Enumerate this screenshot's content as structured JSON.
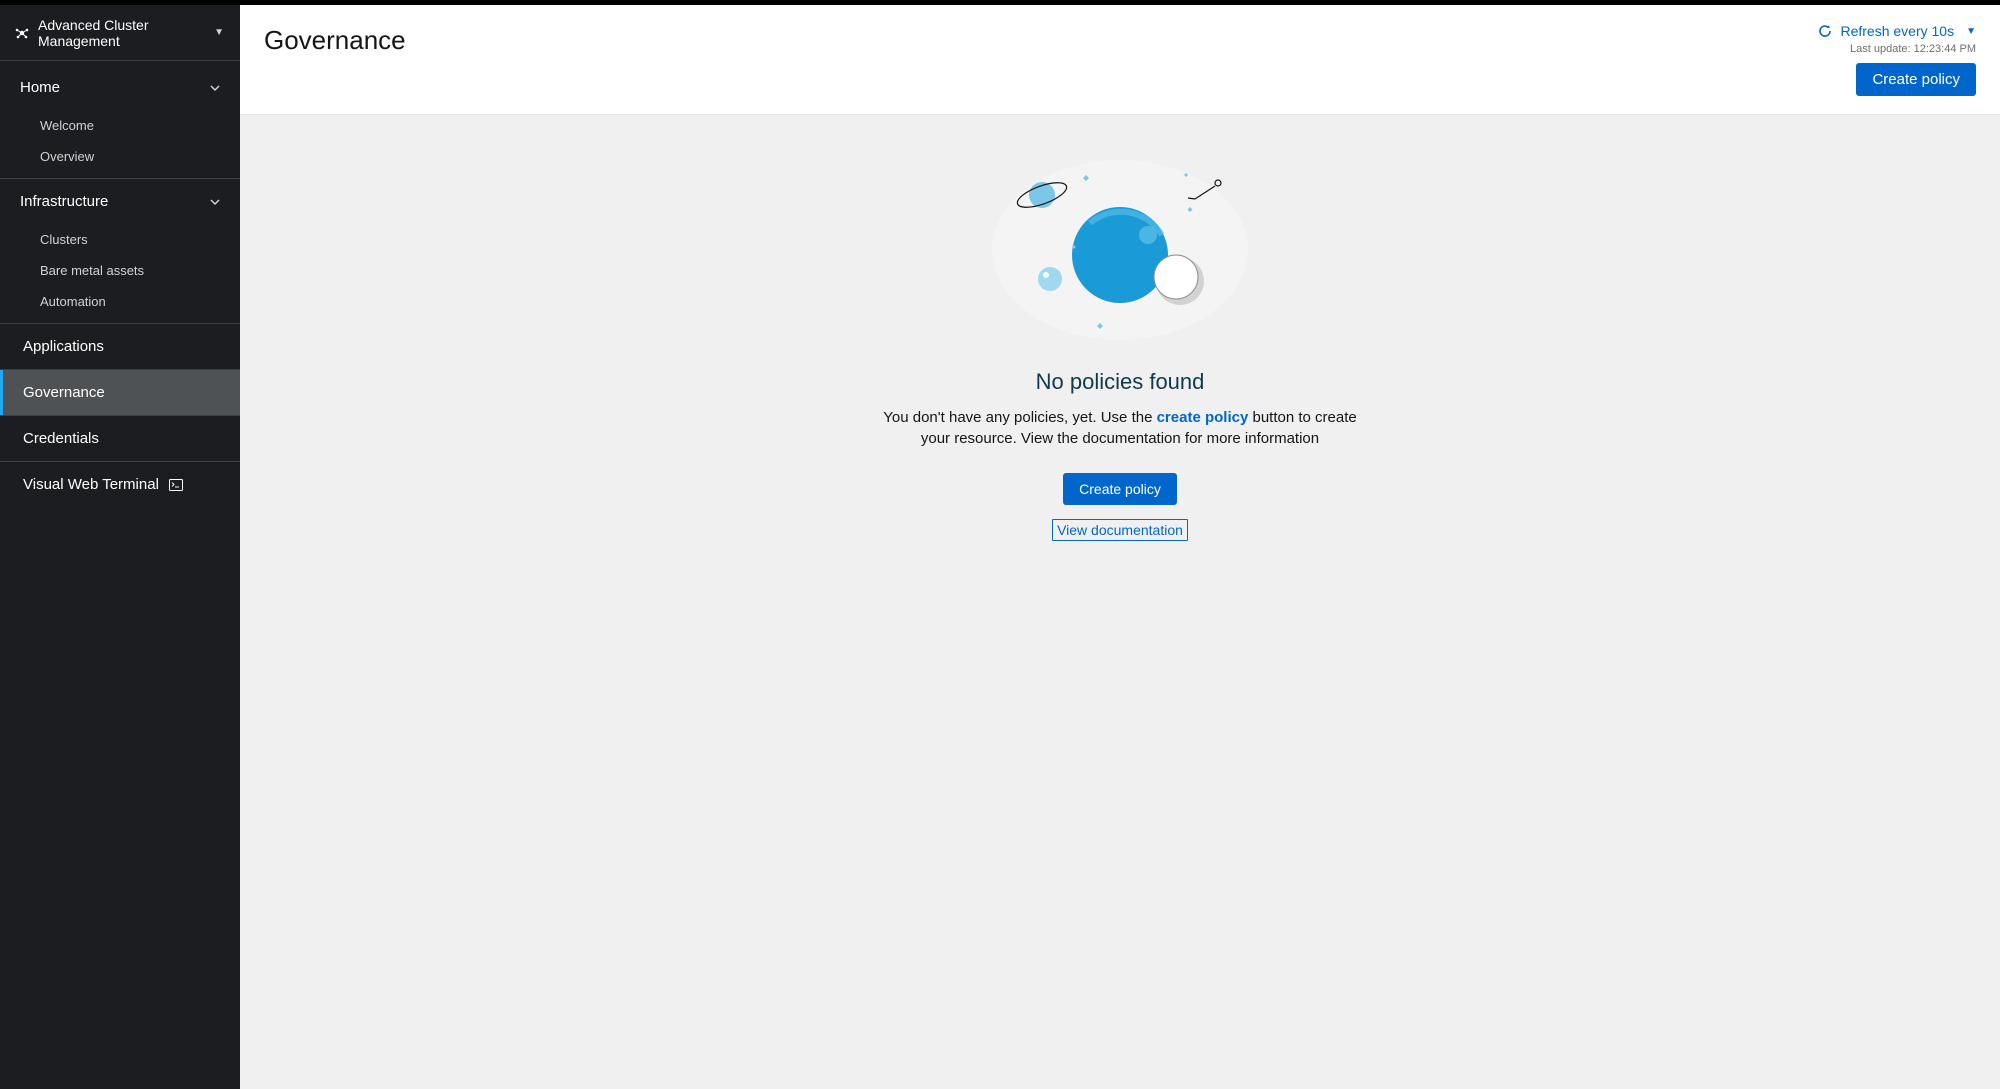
{
  "product_switcher": {
    "label": "Advanced Cluster Management"
  },
  "sidebar": {
    "home": {
      "label": "Home",
      "items": [
        {
          "label": "Welcome"
        },
        {
          "label": "Overview"
        }
      ]
    },
    "infrastructure": {
      "label": "Infrastructure",
      "items": [
        {
          "label": "Clusters"
        },
        {
          "label": "Bare metal assets"
        },
        {
          "label": "Automation"
        }
      ]
    },
    "applications": {
      "label": "Applications"
    },
    "governance": {
      "label": "Governance"
    },
    "credentials": {
      "label": "Credentials"
    },
    "vwt": {
      "label": "Visual Web Terminal"
    }
  },
  "header": {
    "title": "Governance",
    "refresh_label": "Refresh every 10s",
    "last_update_prefix": "Last update: ",
    "last_update_time": "12:23:44 PM",
    "create_policy": "Create policy"
  },
  "empty": {
    "title": "No policies found",
    "desc_before": "You don't have any policies, yet. Use the ",
    "desc_link": "create policy",
    "desc_after": " button to create your resource. View the documentation for more information",
    "primary_button": "Create policy",
    "secondary_link": "View documentation"
  },
  "colors": {
    "accent": "#0066cc",
    "sidebar_bg": "#1b1d21",
    "selected_bg": "#4f5255",
    "selected_border": "#1fa7f8"
  }
}
